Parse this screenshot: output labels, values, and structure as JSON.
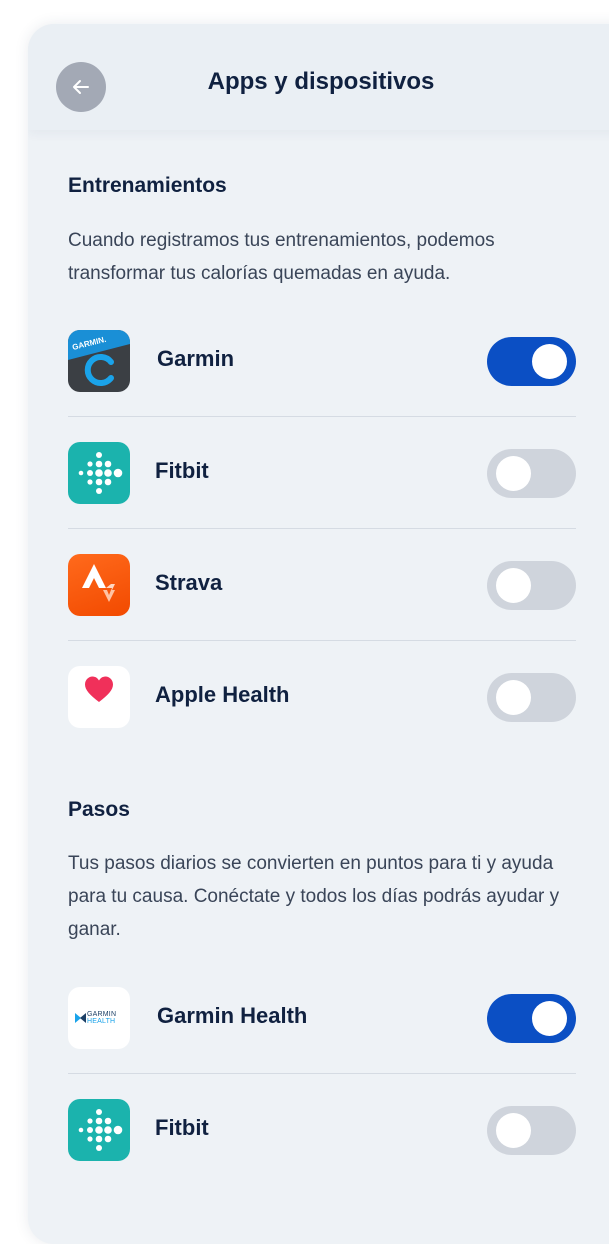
{
  "header": {
    "title": "Apps y dispositivos",
    "back_icon": "arrow-left-icon"
  },
  "sections": [
    {
      "title": "Entrenamientos",
      "description": "Cuando registramos tus entrenamientos, podemos transformar tus calorías quemadas en ayuda.",
      "items": [
        {
          "name": "Garmin",
          "icon": "garmin-connect-icon",
          "enabled": true
        },
        {
          "name": "Fitbit",
          "icon": "fitbit-icon",
          "enabled": false
        },
        {
          "name": "Strava",
          "icon": "strava-icon",
          "enabled": false
        },
        {
          "name": "Apple Health",
          "icon": "apple-health-heart-icon",
          "enabled": false
        }
      ]
    },
    {
      "title": "Pasos",
      "description": "Tus pasos diarios se convierten en puntos para ti y ayuda para tu causa. Conéctate y todos los días podrás ayudar y ganar.",
      "items": [
        {
          "name": "Garmin Health",
          "icon": "garmin-health-icon",
          "logo_text": [
            "GARMIN",
            "HEALTH"
          ],
          "enabled": true
        },
        {
          "name": "Fitbit",
          "icon": "fitbit-icon",
          "enabled": false
        }
      ]
    }
  ],
  "icon_labels": {
    "garmin_connect_text": "GARMIN."
  },
  "colors": {
    "toggle_on": "#0b4fc4",
    "toggle_off": "#cfd4dc",
    "fitbit": "#1bb3ad",
    "strava": "#fc4c02",
    "heart": "#f0305a"
  }
}
